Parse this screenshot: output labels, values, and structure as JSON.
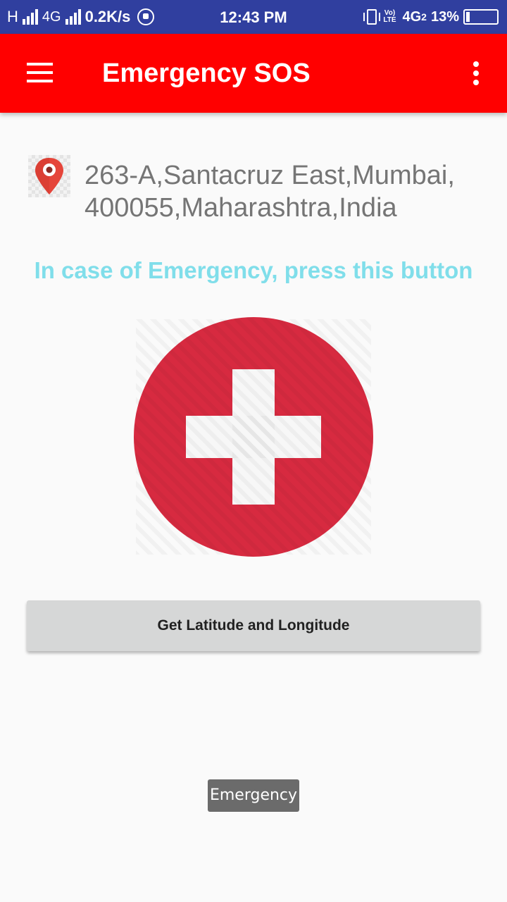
{
  "status_bar": {
    "carrier_indicator": "H",
    "network_1": "4G",
    "net_speed": "0.2K/s",
    "time": "12:43 PM",
    "volte_label": "Vo) LTE",
    "network_2": "4G",
    "sim_index": "2",
    "battery": "13%",
    "battery_level": 0.13,
    "icons": [
      "signal-bars-icon",
      "whatsapp-icon",
      "vibrate-icon",
      "volte-icon",
      "battery-icon"
    ]
  },
  "app_bar": {
    "title": "Emergency SOS",
    "background_color": "#ff0000",
    "icons": [
      "menu-icon",
      "overflow-menu-icon"
    ]
  },
  "location": {
    "icon": "location-pin-icon",
    "address_line1": "263-A,Santacruz East,Mumbai,",
    "address_line2": "400055,Maharashtra,India"
  },
  "hint": {
    "text": "In case of Emergency, press this button",
    "color": "#80deea"
  },
  "sos": {
    "icon": "red-cross-icon",
    "color": "#d72a40"
  },
  "get_coordinates_button": {
    "label": "Get Latitude and Longitude"
  },
  "toast": {
    "text": "Emergency"
  }
}
